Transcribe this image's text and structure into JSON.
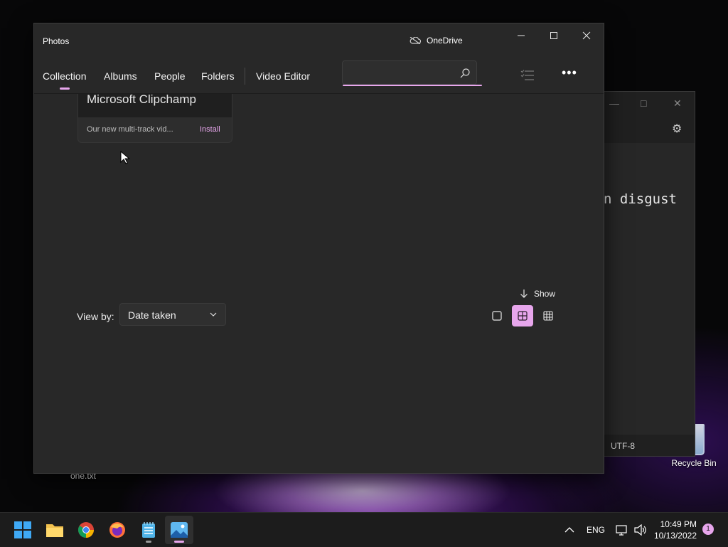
{
  "desktop": {
    "recycle_bin_label": "Recycle Bin",
    "file_label": "one.txt"
  },
  "notepad": {
    "visible_text": "n disgust",
    "encoding": "UTF-8"
  },
  "photos": {
    "title": "Photos",
    "onedrive_label": "OneDrive",
    "tabs": [
      {
        "label": "Collection",
        "active": true
      },
      {
        "label": "Albums",
        "active": false
      },
      {
        "label": "People",
        "active": false
      },
      {
        "label": "Folders",
        "active": false
      },
      {
        "label": "Video Editor",
        "active": false
      }
    ],
    "search": {
      "placeholder": ""
    },
    "promo": {
      "title": "Microsoft Clipchamp",
      "description": "Our new multi-track vid...",
      "install_label": "Install"
    },
    "show_label": "Show",
    "view_by_label": "View by:",
    "view_by_value": "Date taken",
    "view_sizes": [
      "large",
      "medium",
      "small"
    ],
    "selected_view_size": "medium"
  },
  "taskbar": {
    "apps": [
      "start",
      "file-explorer",
      "chrome",
      "firefox",
      "notepad",
      "photos"
    ],
    "active_app": "photos",
    "language": "ENG",
    "time": "10:49 PM",
    "date": "10/13/2022",
    "notification_count": "1"
  },
  "colors": {
    "accent": "#e7a6ec",
    "window_bg": "#282828",
    "taskbar_bg": "#1c1c1c"
  }
}
